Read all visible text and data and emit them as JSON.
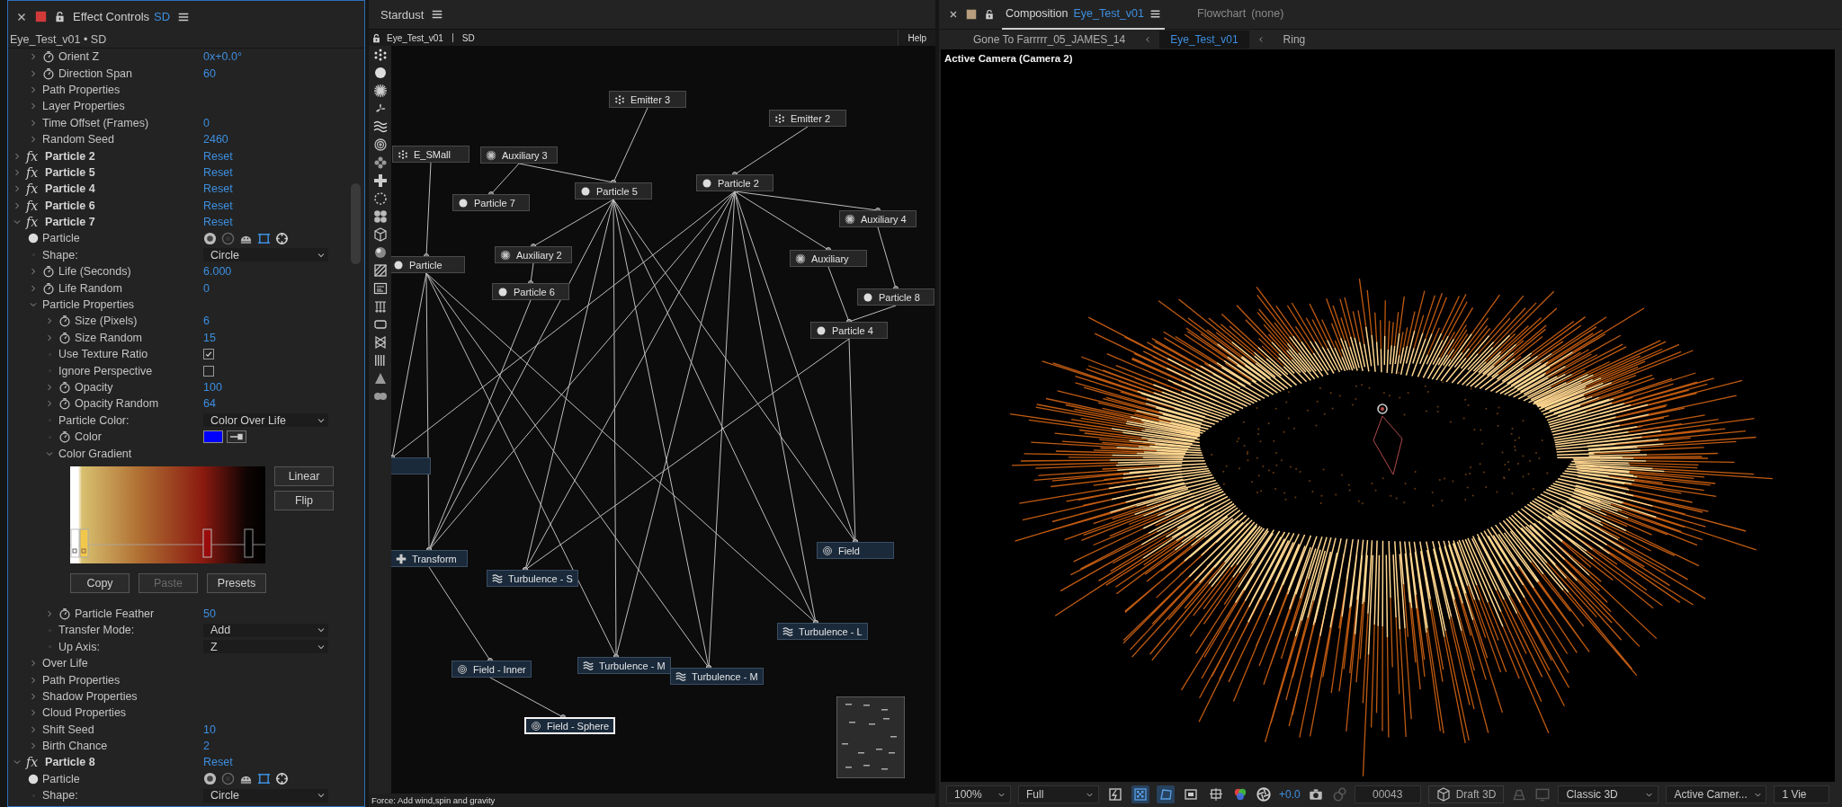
{
  "effect_controls": {
    "title": "Effect Controls",
    "layer": "SD",
    "source": "Eye_Test_v01 • SD",
    "rows": [
      {
        "kind": "continuation",
        "children": [
          {
            "kind": "param",
            "label": "Orient Z",
            "value": "0x+0.0°",
            "expanded": false
          },
          {
            "kind": "param",
            "label": "Direction Span",
            "value": "60",
            "expanded": false
          },
          {
            "kind": "group",
            "label": "Path Properties",
            "expanded": false
          },
          {
            "kind": "group",
            "label": "Layer Properties",
            "expanded": false
          },
          {
            "kind": "group",
            "label": "Time Offset (Frames)",
            "value": "0",
            "expanded": false
          },
          {
            "kind": "group",
            "label": "Random Seed",
            "value": "2460",
            "expanded": false
          }
        ]
      },
      {
        "kind": "effect",
        "badge": "fx",
        "label": "Particle 2",
        "action": "Reset",
        "expanded": false
      },
      {
        "kind": "effect",
        "badge": "fx",
        "label": "Particle 5",
        "action": "Reset",
        "expanded": false
      },
      {
        "kind": "effect",
        "badge": "fx",
        "label": "Particle 4",
        "action": "Reset",
        "expanded": false
      },
      {
        "kind": "effect",
        "badge": "fx",
        "label": "Particle 6",
        "action": "Reset",
        "expanded": false
      },
      {
        "kind": "effect",
        "badge": "fx",
        "label": "Particle 7",
        "action": "Reset",
        "expanded": true,
        "children": [
          {
            "kind": "particle-type",
            "label": "Particle"
          },
          {
            "kind": "dropdown",
            "label": "Shape:",
            "value": "Circle"
          },
          {
            "kind": "param",
            "label": "Life (Seconds)",
            "value": "6.000",
            "expanded": false
          },
          {
            "kind": "param",
            "label": "Life Random",
            "value": "0",
            "expanded": false
          },
          {
            "kind": "group",
            "label": "Particle Properties",
            "expanded": true,
            "children": [
              {
                "kind": "param",
                "label": "Size (Pixels)",
                "value": "6",
                "expanded": false
              },
              {
                "kind": "param",
                "label": "Size Random",
                "value": "15",
                "expanded": false
              },
              {
                "kind": "checkbox",
                "label": "Use Texture Ratio",
                "checked": true
              },
              {
                "kind": "checkbox",
                "label": "Ignore Perspective",
                "checked": false
              },
              {
                "kind": "param",
                "label": "Opacity",
                "value": "100",
                "expanded": false
              },
              {
                "kind": "param",
                "label": "Opacity Random",
                "value": "64",
                "expanded": false
              },
              {
                "kind": "dropdown",
                "label": "Particle Color:",
                "value": "Color Over Life"
              },
              {
                "kind": "color",
                "label": "Color",
                "color": "#0000ff"
              },
              {
                "kind": "group",
                "label": "Color Gradient",
                "expanded": true,
                "children": [
                  {
                    "kind": "gradient",
                    "side_buttons": [
                      {
                        "label": "Linear"
                      },
                      {
                        "label": "Flip"
                      }
                    ],
                    "actions": [
                      {
                        "label": "Copy",
                        "disabled": false
                      },
                      {
                        "label": "Paste",
                        "disabled": true
                      },
                      {
                        "label": "Presets",
                        "disabled": false
                      }
                    ]
                  }
                ]
              },
              {
                "kind": "param",
                "label": "Particle Feather",
                "value": "50",
                "expanded": false
              },
              {
                "kind": "dropdown",
                "label": "Transfer Mode:",
                "value": "Add"
              },
              {
                "kind": "dropdown",
                "label": "Up Axis:",
                "value": "Z"
              }
            ]
          },
          {
            "kind": "group",
            "label": "Over Life",
            "expanded": false
          },
          {
            "kind": "group",
            "label": "Path Properties",
            "expanded": false
          },
          {
            "kind": "group",
            "label": "Shadow Properties",
            "expanded": false
          },
          {
            "kind": "group",
            "label": "Cloud Properties",
            "expanded": false
          },
          {
            "kind": "group",
            "label": "Shift Seed",
            "value": "10",
            "expanded": false
          },
          {
            "kind": "group",
            "label": "Birth Chance",
            "value": "2",
            "expanded": false
          }
        ]
      },
      {
        "kind": "effect",
        "badge": "fx",
        "label": "Particle 8",
        "action": "Reset",
        "expanded": true,
        "children": [
          {
            "kind": "particle-type",
            "label": "Particle"
          },
          {
            "kind": "dropdown",
            "label": "Shape:",
            "value": "Circle"
          }
        ]
      }
    ]
  },
  "stardust": {
    "title": "Stardust",
    "comp": "Eye_Test_v01",
    "layer": "SD",
    "help": "Help",
    "status": "Force: Add wind,spin and gravity",
    "nodes": [
      {
        "kind": "emitter",
        "label": "Emitter 3",
        "selected": false
      },
      {
        "kind": "emitter",
        "label": "Emitter 2",
        "selected": false
      },
      {
        "kind": "emitter",
        "label": "E_SMall",
        "selected": false
      },
      {
        "kind": "auxiliary",
        "label": "Auxiliary 3",
        "selected": false
      },
      {
        "kind": "particle",
        "label": "Particle 2",
        "selected": false
      },
      {
        "kind": "particle",
        "label": "Particle 5",
        "selected": false
      },
      {
        "kind": "particle",
        "label": "Particle 7",
        "selected": false
      },
      {
        "kind": "auxiliary",
        "label": "Auxiliary 4",
        "selected": false
      },
      {
        "kind": "auxiliary",
        "label": "Auxiliary 2",
        "selected": false
      },
      {
        "kind": "auxiliary",
        "label": "Auxiliary",
        "selected": false
      },
      {
        "kind": "particle",
        "label": "Particle",
        "selected": false
      },
      {
        "kind": "particle",
        "label": "Particle 6",
        "selected": false
      },
      {
        "kind": "particle",
        "label": "Particle 8",
        "selected": false
      },
      {
        "kind": "particle",
        "label": "Particle 4",
        "selected": false
      },
      {
        "kind": "field",
        "selected": false
      },
      {
        "kind": "field",
        "label": "Field",
        "selected": false
      },
      {
        "kind": "transform",
        "label": "Transform",
        "selected": false
      },
      {
        "kind": "turbulence",
        "label": "Turbulence - S",
        "selected": false
      },
      {
        "kind": "turbulence",
        "label": "Turbulence - L",
        "selected": false
      },
      {
        "kind": "turbulence",
        "label": "Turbulence - M",
        "selected": false
      },
      {
        "kind": "field",
        "label": "Field - Inner",
        "selected": false
      },
      {
        "kind": "turbulence",
        "label": "Turbulence - M",
        "selected": false
      },
      {
        "kind": "field",
        "label": "Field  - Sphere",
        "selected": true
      }
    ]
  },
  "composition": {
    "tabs": [
      {
        "label": "Composition",
        "comp": "Eye_Test_v01",
        "selected": true
      },
      {
        "label": "Flowchart",
        "comp": "(none)",
        "selected": false
      }
    ],
    "breadcrumbs": [
      {
        "label": "Gone To Farrrrr_05_JAMES_14",
        "selected": false
      },
      {
        "label": "Eye_Test_v01",
        "selected": true
      },
      {
        "label": "Ring",
        "selected": false
      }
    ],
    "view_label": "Active Camera (Camera 2)",
    "toolbar": {
      "zoom": "100%",
      "resolution": "Full",
      "toggles": [
        {
          "on": false
        },
        {
          "on": true
        },
        {
          "on": true
        },
        {
          "on": false
        },
        {
          "on": false
        }
      ],
      "exposure": "+0.0",
      "frame": "00043",
      "renderer": "Draft 3D",
      "renderer_mode": "Classic 3D",
      "view": "Active Camer...",
      "layout": "1 Vie"
    }
  }
}
